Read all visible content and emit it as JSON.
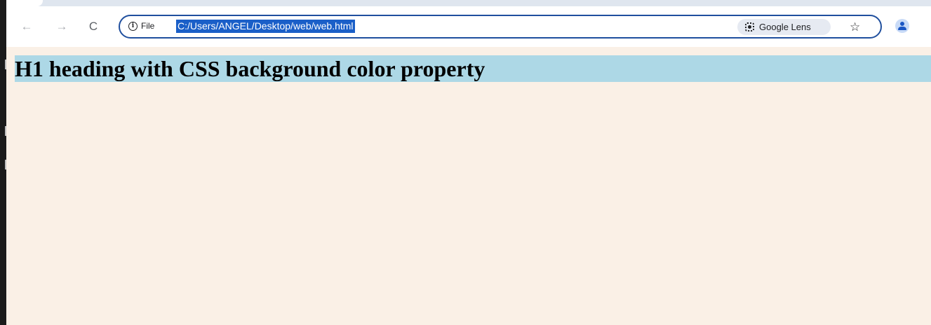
{
  "browser": {
    "nav": {
      "back_glyph": "←",
      "forward_glyph": "→",
      "reload_glyph": "C"
    },
    "omnibox": {
      "site_info_label": "File",
      "url": "C:/Users/ANGEL/Desktop/web/web.html",
      "url_selected": true
    },
    "actions": {
      "lens_label": "Google Lens",
      "bookmark_glyph": "☆"
    },
    "icons": [
      "back-arrow-icon",
      "forward-arrow-icon",
      "reload-icon",
      "info-icon",
      "google-lens-icon",
      "bookmark-star-icon",
      "profile-icon"
    ]
  },
  "page": {
    "heading": "H1 heading with CSS background color property"
  },
  "colors": {
    "omnibox_border": "#1f4f9e",
    "url_selection": "#1a5fc8",
    "page_background": "#faf0e6",
    "heading_background": "#add8e6",
    "lens_chip": "#e6eaf2",
    "profile_icon": "#1a56c4"
  }
}
